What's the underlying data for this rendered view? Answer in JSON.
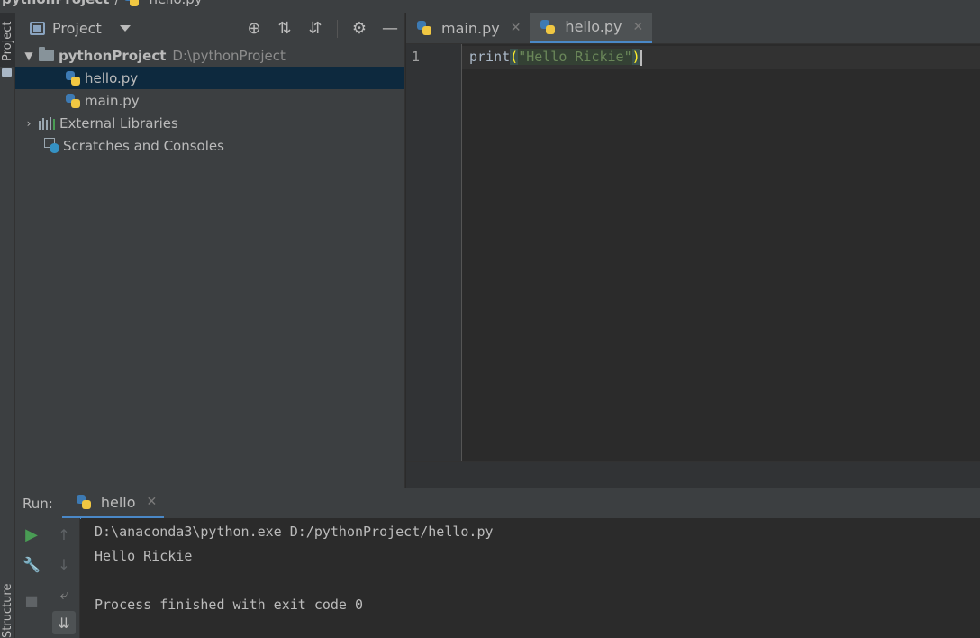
{
  "breadcrumb": {
    "project": "pythonProject",
    "separator": "/",
    "file": "hello.py"
  },
  "sidebar_tabs": {
    "project": "Project",
    "structure": "Structure"
  },
  "project_panel": {
    "title": "Project",
    "toolbar": [
      "locate-icon",
      "expand-all-icon",
      "collapse-all-icon",
      "gear-icon",
      "minimize-icon"
    ],
    "tree": {
      "root_name": "pythonProject",
      "root_path": "D:\\pythonProject",
      "files": [
        "hello.py",
        "main.py"
      ],
      "external_libraries": "External Libraries",
      "scratches": "Scratches and Consoles"
    }
  },
  "editor": {
    "tabs": [
      "main.py",
      "hello.py"
    ],
    "active_tab": "hello.py",
    "line_number": "1",
    "code": {
      "func": "print",
      "open": "(",
      "string": "\"Hello Rickie\"",
      "close": ")"
    }
  },
  "run": {
    "label": "Run:",
    "tab": "hello",
    "console": [
      "D:\\anaconda3\\python.exe D:/pythonProject/hello.py",
      "Hello Rickie",
      "",
      "Process finished with exit code 0"
    ]
  },
  "colors": {
    "background": "#2b2b2b",
    "panel": "#3c3f41",
    "selection": "#0d293e",
    "accent": "#4a88c7",
    "string": "#6a8759",
    "run_green": "#499c54"
  }
}
